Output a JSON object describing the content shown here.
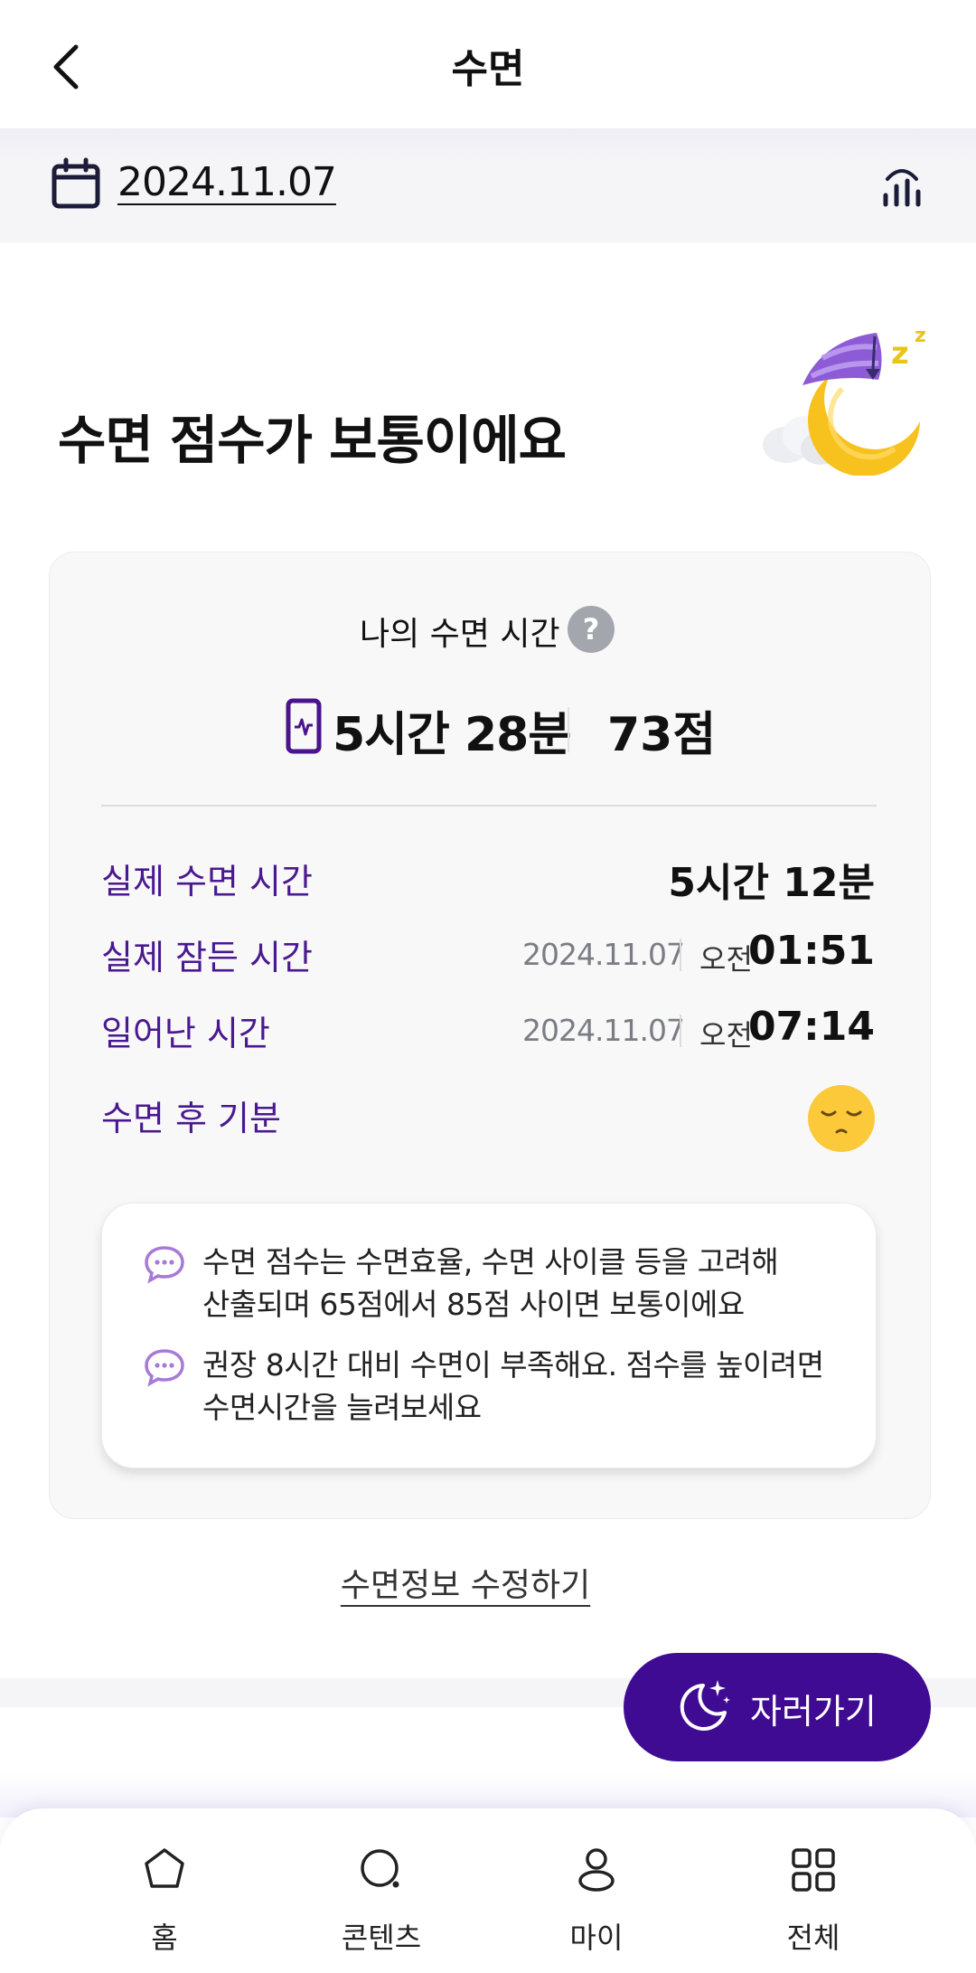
{
  "header": {
    "title": "수면"
  },
  "datebar": {
    "date": "2024.11.07"
  },
  "headline": "수면 점수가 보통이에요",
  "card": {
    "title": "나의 수면 시간",
    "help_icon_glyph": "?",
    "total_time": "5시간 28분",
    "score": "73점",
    "rows": {
      "actual_sleep": {
        "label": "실제 수면 시간",
        "value": "5시간 12분"
      },
      "fell_asleep": {
        "label": "실제 잠든 시간",
        "date": "2024.11.07",
        "ampm": "오전",
        "time": "01:51"
      },
      "woke_up": {
        "label": "일어난 시간",
        "date": "2024.11.07",
        "ampm": "오전",
        "time": "07:14"
      },
      "mood": {
        "label": "수면 후 기분",
        "icon": "sleepy-face"
      }
    },
    "tips": [
      {
        "line1": "수면 점수는 수면효율, 수면 사이클 등을 고려해",
        "line2": "산출되며 65점에서 85점 사이면 보통이에요"
      },
      {
        "line1": "권장 8시간 대비 수면이 부족해요. 점수를 높이려면",
        "line2": "수면시간을 늘려보세요"
      }
    ]
  },
  "edit_link": "수면정보 수정하기",
  "sleep_button": {
    "label": "자러가기"
  },
  "tabbar": {
    "items": [
      {
        "label": "홈",
        "icon": "home-icon"
      },
      {
        "label": "콘텐츠",
        "icon": "content-icon"
      },
      {
        "label": "마이",
        "icon": "person-icon"
      },
      {
        "label": "전체",
        "icon": "grid-icon"
      }
    ]
  },
  "colors": {
    "accent_purple": "#3f0b92",
    "label_purple": "#4a1890",
    "moon_yellow": "#f7c21e",
    "cap_purple": "#8d5bd6"
  }
}
